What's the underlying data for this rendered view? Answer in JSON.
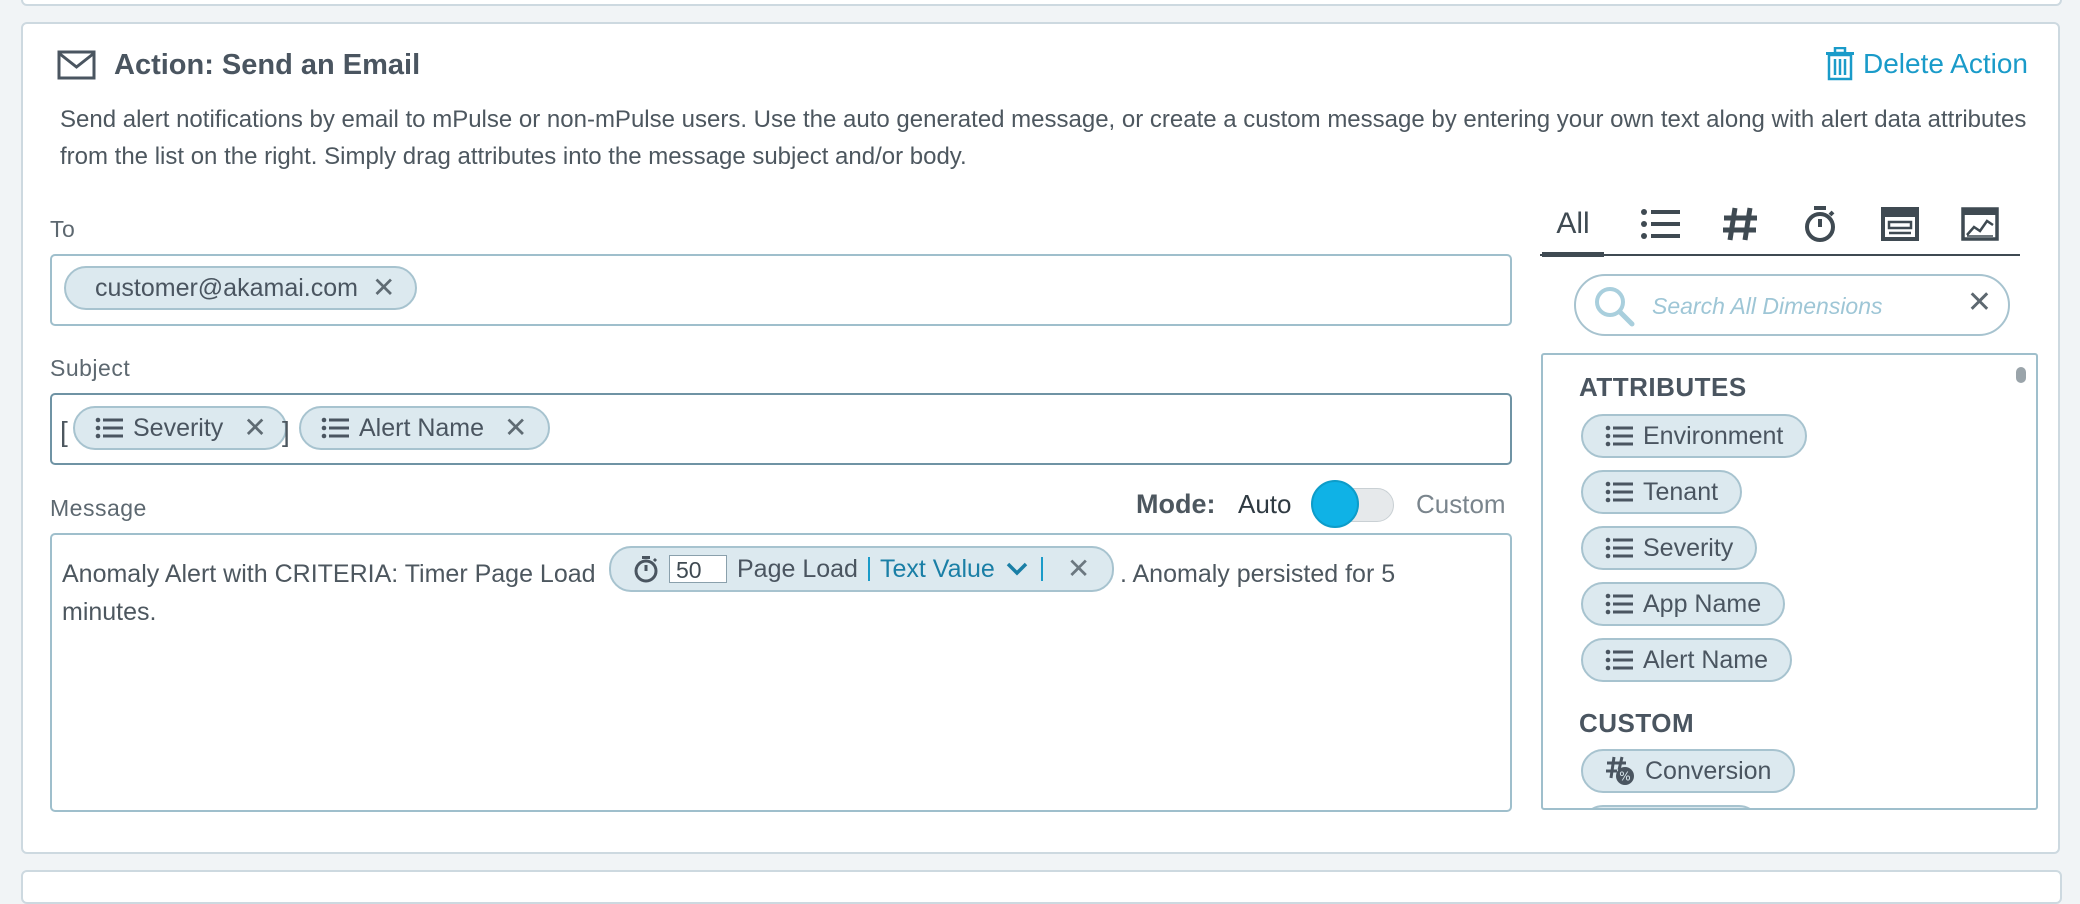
{
  "header": {
    "title": "Action: Send an Email",
    "delete_label": "Delete Action",
    "description": "Send alert notifications by email to mPulse or non-mPulse users. Use the auto generated message, or create a custom message by entering your own text along with alert data attributes from the list on the right. Simply drag attributes into the message subject and/or body."
  },
  "to": {
    "label": "To",
    "recipients": [
      "customer@akamai.com"
    ]
  },
  "subject": {
    "label": "Subject",
    "open_bracket": "[",
    "close_bracket": "]",
    "tokens": [
      "Severity",
      "Alert Name"
    ]
  },
  "mode": {
    "label": "Mode:",
    "auto": "Auto",
    "custom": "Custom",
    "selected": "Auto"
  },
  "message": {
    "label": "Message",
    "text_before": "Anomaly Alert with CRITERIA: Timer Page Load",
    "token": {
      "value": "50",
      "name": "Page Load",
      "format": "Text Value"
    },
    "text_after_line1": ". Anomaly persisted for 5",
    "text_after_line2": "minutes."
  },
  "dimensions": {
    "tabs": [
      {
        "label": "All",
        "icon": "all",
        "active": true
      },
      {
        "label": "",
        "icon": "list-icon"
      },
      {
        "label": "",
        "icon": "hash-icon"
      },
      {
        "label": "",
        "icon": "timer-icon"
      },
      {
        "label": "",
        "icon": "page-icon"
      },
      {
        "label": "",
        "icon": "chart-icon"
      }
    ],
    "search_placeholder": "Search All Dimensions",
    "attributes_title": "ATTRIBUTES",
    "attributes": [
      "Environment",
      "Tenant",
      "Severity",
      "App Name",
      "Alert Name"
    ],
    "custom_title": "CUSTOM",
    "custom": [
      "Conversion"
    ]
  },
  "colors": {
    "accent": "#1a9bc9",
    "toggle": "#0fb2e6",
    "pill_bg": "#dce9ef"
  }
}
